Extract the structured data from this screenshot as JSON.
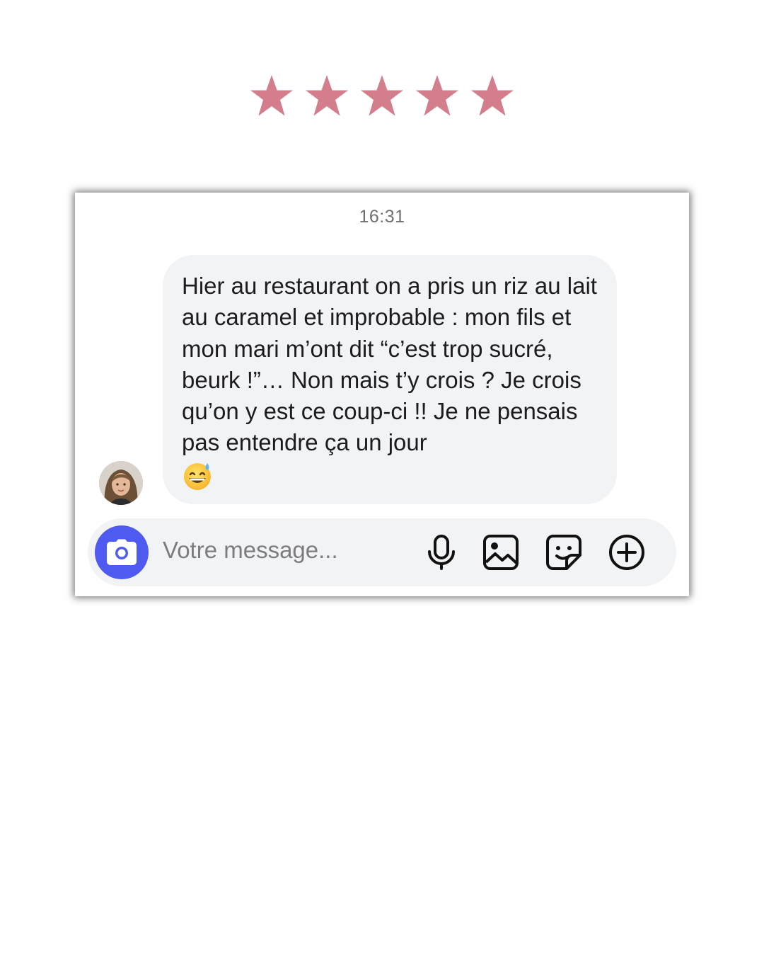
{
  "rating": {
    "stars": 5,
    "max": 5,
    "color": "#d47d8d"
  },
  "conversation": {
    "timestamp": "16:31",
    "message": {
      "text": "Hier au restaurant on a pris un riz au lait au caramel et improbable : mon fils et mon mari m’ont dit “c’est trop sucré, beurk !”… Non mais t’y crois ? Je crois qu’on y est ce coup-ci !! Je ne pensais pas entendre ça un jour",
      "emoji": "grinning-face-with-sweat"
    }
  },
  "composer": {
    "placeholder": "Votre message...",
    "camera_button_color": "#4f5bf0",
    "icons": [
      "camera-icon",
      "microphone-icon",
      "image-icon",
      "sticker-icon",
      "plus-circle-icon"
    ]
  }
}
